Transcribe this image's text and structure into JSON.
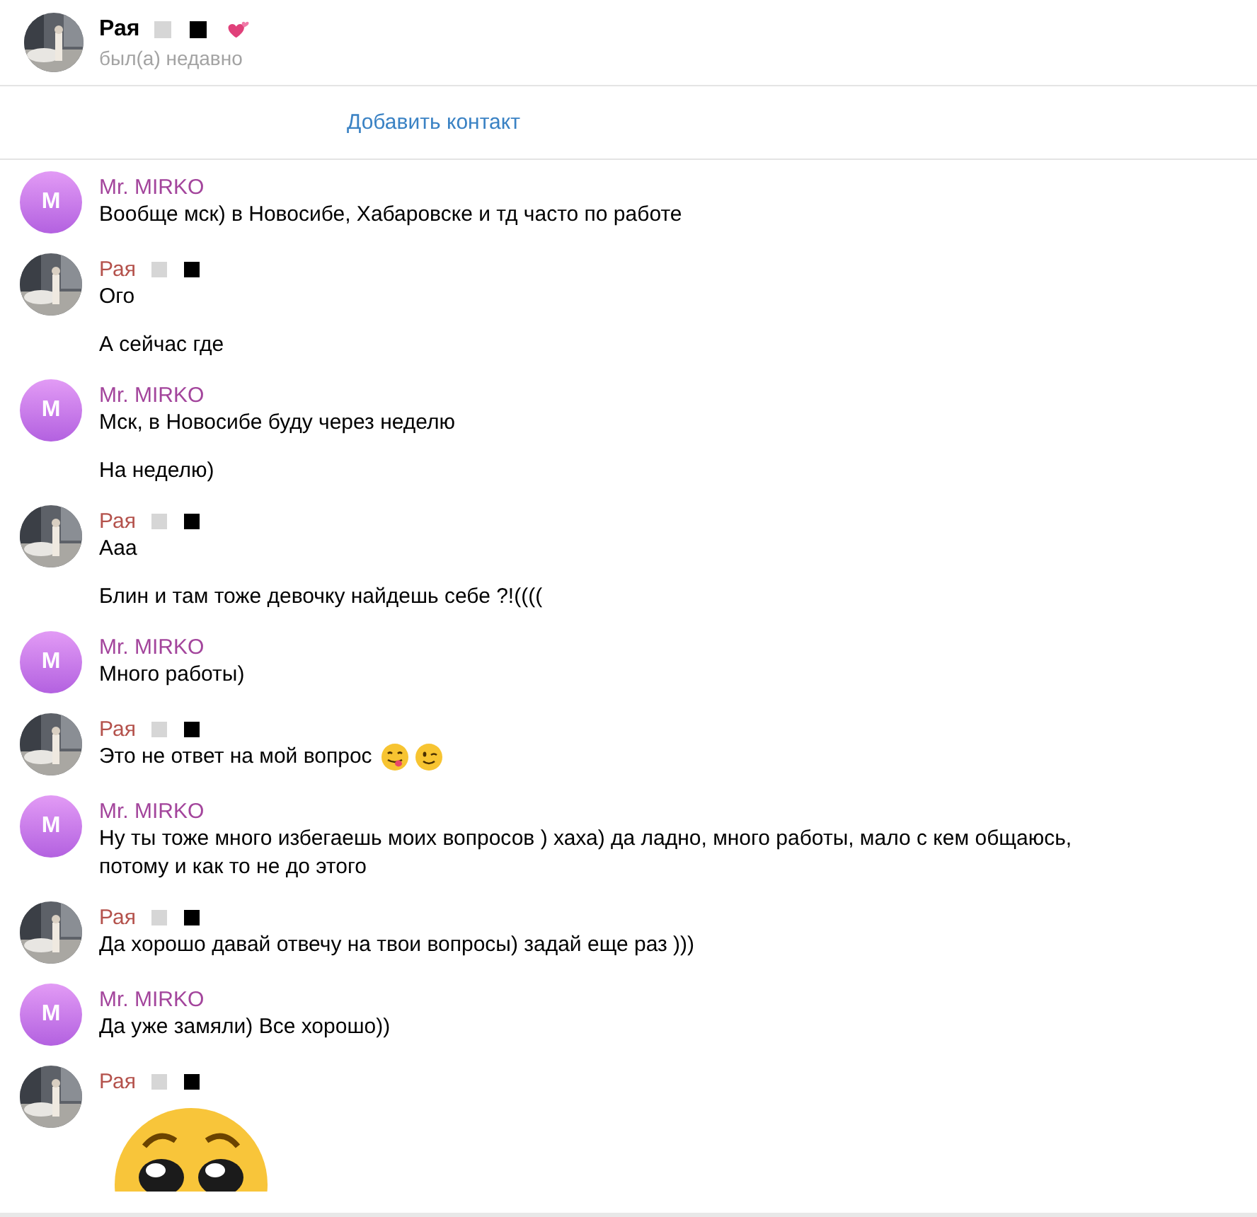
{
  "header": {
    "name": "Рая",
    "status": "был(а) недавно"
  },
  "add_contact": "Добавить контакт",
  "groups": [
    {
      "kind": "contact",
      "name": "Mr. MIRKO",
      "initial": "M",
      "messages": [
        {
          "kind": "text",
          "text": "Вообще мск) в Новосибе, Хабаровске и тд часто по работе"
        }
      ]
    },
    {
      "kind": "peer",
      "name": "Рая",
      "messages": [
        {
          "kind": "text",
          "text": "Ого"
        },
        {
          "kind": "text",
          "text": "А сейчас где"
        }
      ]
    },
    {
      "kind": "contact",
      "name": "Mr. MIRKO",
      "initial": "M",
      "messages": [
        {
          "kind": "text",
          "text": "Мск, в Новосибе буду через неделю"
        },
        {
          "kind": "text",
          "text": "На неделю)"
        }
      ]
    },
    {
      "kind": "peer",
      "name": "Рая",
      "messages": [
        {
          "kind": "text",
          "text": "Ааа"
        },
        {
          "kind": "text",
          "text": "Блин и там тоже девочку найдешь себе ?!(((("
        }
      ]
    },
    {
      "kind": "contact",
      "name": "Mr. MIRKO",
      "initial": "M",
      "messages": [
        {
          "kind": "text",
          "text": "Много работы)"
        }
      ]
    },
    {
      "kind": "peer",
      "name": "Рая",
      "messages": [
        {
          "kind": "emoji_text",
          "text": "Это не ответ на мой вопрос"
        }
      ]
    },
    {
      "kind": "contact",
      "name": "Mr. MIRKO",
      "initial": "M",
      "messages": [
        {
          "kind": "text",
          "text": "Ну ты тоже много избегаешь моих вопросов ) хаха) да ладно, много работы, мало с кем общаюсь, потому и как то не до этого"
        }
      ]
    },
    {
      "kind": "peer",
      "name": "Рая",
      "messages": [
        {
          "kind": "text",
          "text": "Да хорошо давай отвечу на твои вопросы) задай еще раз )))"
        }
      ]
    },
    {
      "kind": "contact",
      "name": "Mr. MIRKO",
      "initial": "M",
      "messages": [
        {
          "kind": "text",
          "text": "Да уже замяли) Все хорошо))"
        }
      ]
    },
    {
      "kind": "peer",
      "name": "Рая",
      "messages": [
        {
          "kind": "sticker"
        }
      ]
    }
  ]
}
